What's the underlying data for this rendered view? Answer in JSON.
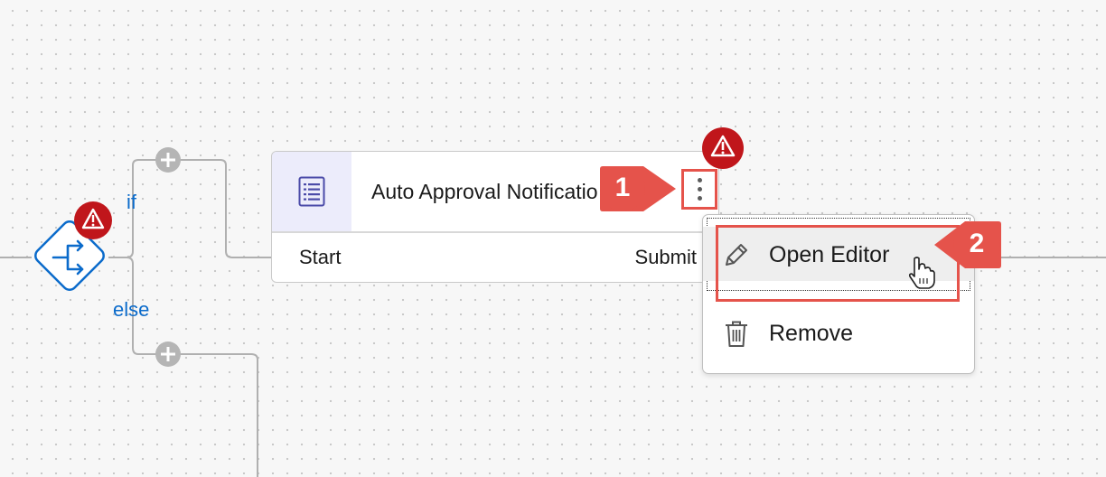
{
  "flow": {
    "branch_if_label": "if",
    "branch_else_label": "else"
  },
  "step_card": {
    "title": "Auto Approval Notification",
    "footer_left": "Start",
    "footer_right": "Submit",
    "icon": "form-list-icon"
  },
  "context_menu": {
    "items": [
      {
        "label": "Open Editor",
        "icon": "pencil-icon"
      },
      {
        "label": "Remove",
        "icon": "trash-icon"
      }
    ]
  },
  "annotations": {
    "callout_1": "1",
    "callout_2": "2"
  },
  "colors": {
    "canvas_bg": "#f7f7f7",
    "accent_blue": "#0b6bcb",
    "warning_red": "#c0161b",
    "annotation_red": "#e5534b",
    "card_icon_bg": "#ececfb"
  }
}
